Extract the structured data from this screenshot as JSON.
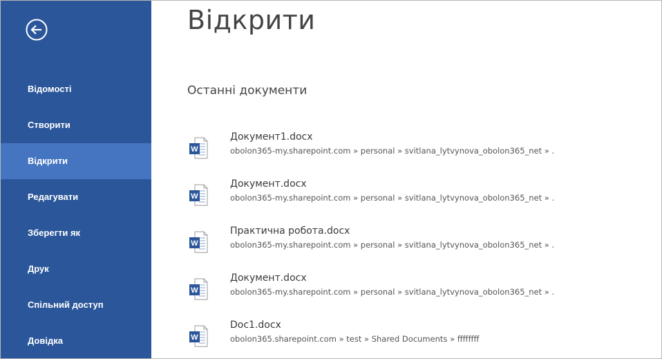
{
  "colors": {
    "sidebar_bg": "#2b579a",
    "sidebar_active": "#4575c1",
    "word_icon_blue": "#2b579a"
  },
  "sidebar": {
    "back_icon": "back-arrow-circle-icon",
    "items": [
      {
        "label": "Відомості",
        "active": false
      },
      {
        "label": "Створити",
        "active": false
      },
      {
        "label": "Відкрити",
        "active": true
      },
      {
        "label": "Редагувати",
        "active": false
      },
      {
        "label": "Зберегти як",
        "active": false
      },
      {
        "label": "Друк",
        "active": false
      },
      {
        "label": "Спільний доступ",
        "active": false
      },
      {
        "label": "Довідка",
        "active": false
      }
    ]
  },
  "main": {
    "title": "Відкрити",
    "section_title": "Останні документи",
    "documents": [
      {
        "name": "Документ1.docx",
        "path": "obolon365-my.sharepoint.com » personal » svitlana_lytvynova_obolon365_net » .",
        "icon": "word-document-icon"
      },
      {
        "name": "Документ.docx",
        "path": "obolon365-my.sharepoint.com » personal » svitlana_lytvynova_obolon365_net » .",
        "icon": "word-document-icon"
      },
      {
        "name": "Практична робота.docx",
        "path": "obolon365-my.sharepoint.com » personal » svitlana_lytvynova_obolon365_net » .",
        "icon": "word-document-icon"
      },
      {
        "name": "Документ.docx",
        "path": "obolon365-my.sharepoint.com » personal » svitlana_lytvynova_obolon365_net » .",
        "icon": "word-document-icon"
      },
      {
        "name": "Doc1.docx",
        "path": "obolon365.sharepoint.com » test » Shared Documents » ffffffff",
        "icon": "word-document-icon"
      }
    ]
  }
}
